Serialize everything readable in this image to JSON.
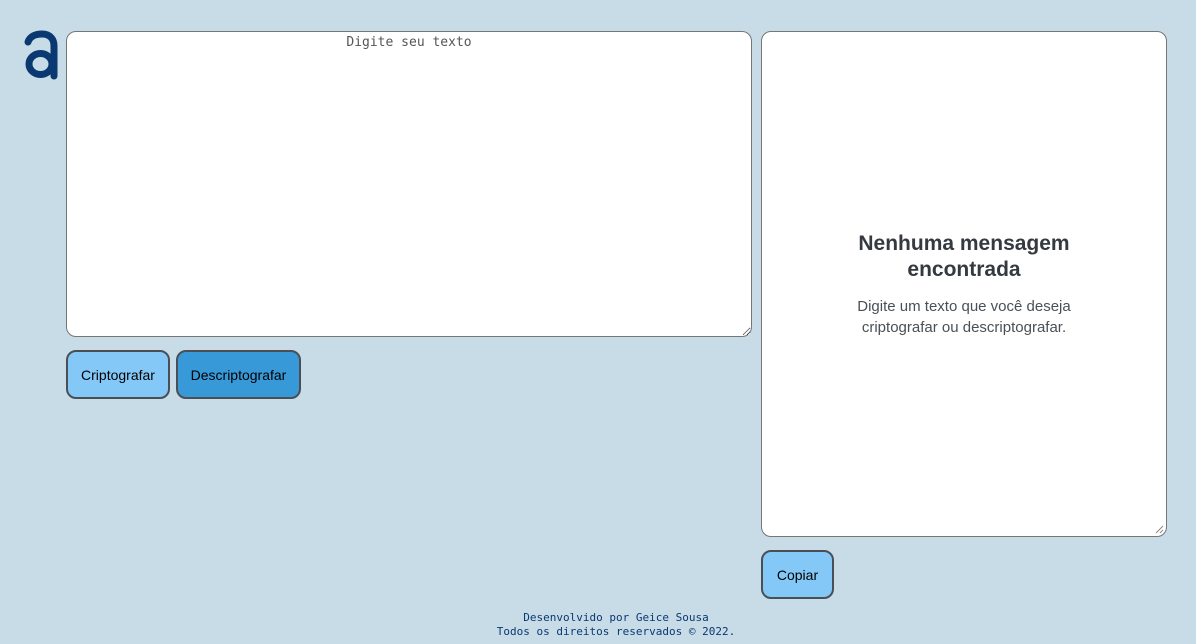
{
  "colors": {
    "background": "#c8dce7",
    "brand": "#0a3871",
    "button_primary": "#84c8f8",
    "button_secondary": "#3899d9"
  },
  "logo": {
    "icon": "alura-a-logo-icon"
  },
  "input": {
    "placeholder": "Digite seu texto",
    "value": ""
  },
  "buttons": {
    "encrypt_label": "Criptografar",
    "decrypt_label": "Descriptografar",
    "copy_label": "Copiar"
  },
  "output": {
    "title": "Nenhuma mensagem encontrada",
    "description": "Digite um texto que você deseja criptografar ou descriptografar."
  },
  "footer": {
    "line1": "Desenvolvido por Geice Sousa",
    "line2": "Todos os direitos reservados © 2022."
  }
}
